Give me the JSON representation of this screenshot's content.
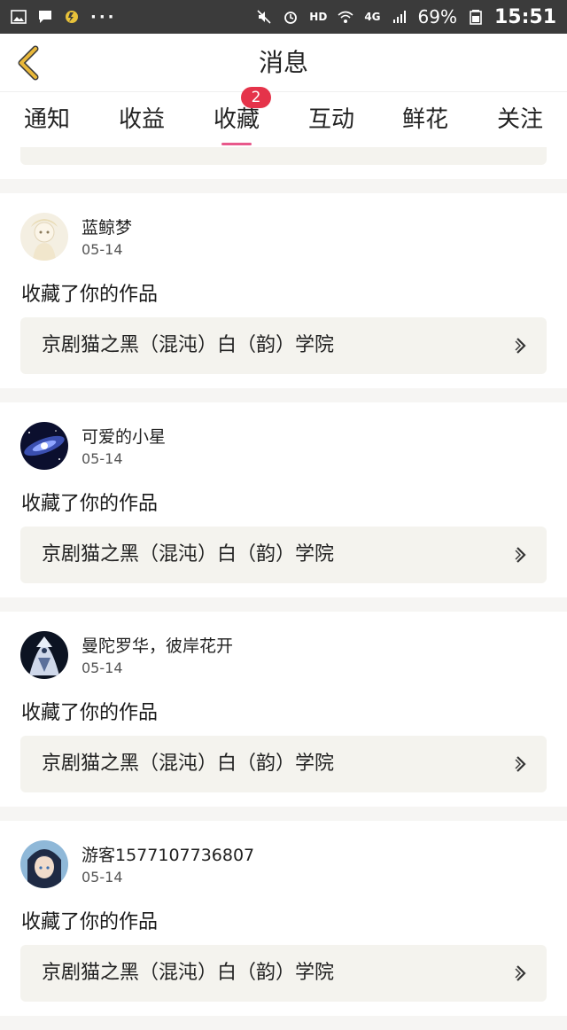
{
  "status_bar": {
    "left_icons": [
      "gallery-icon",
      "message-icon",
      "app-icon"
    ],
    "more": "···",
    "hd": "HD",
    "network": "4G",
    "battery": "69%",
    "time": "15:51"
  },
  "header": {
    "title": "消息",
    "back_icon": "back-chevron-icon"
  },
  "tabs": [
    {
      "label": "通知"
    },
    {
      "label": "收益"
    },
    {
      "label": "收藏",
      "badge": "2",
      "active": true
    },
    {
      "label": "互动"
    },
    {
      "label": "鲜花"
    },
    {
      "label": "关注"
    }
  ],
  "messages": [
    {
      "username": "蓝鲸梦",
      "date": "05-14",
      "action": "收藏了你的作品",
      "work": "京剧猫之黑（混沌）白（韵）学院"
    },
    {
      "username": "可爱的小星",
      "date": "05-14",
      "action": "收藏了你的作品",
      "work": "京剧猫之黑（混沌）白（韵）学院"
    },
    {
      "username": "曼陀罗华，彼岸花开",
      "date": "05-14",
      "action": "收藏了你的作品",
      "work": "京剧猫之黑（混沌）白（韵）学院"
    },
    {
      "username": "游客1577107736807",
      "date": "05-14",
      "action": "收藏了你的作品",
      "work": "京剧猫之黑（混沌）白（韵）学院"
    }
  ],
  "colors": {
    "accent": "#e8588a",
    "badge": "#e5334a",
    "back_arrow": "#e9b83a",
    "card_inner": "#f4f3ee"
  }
}
